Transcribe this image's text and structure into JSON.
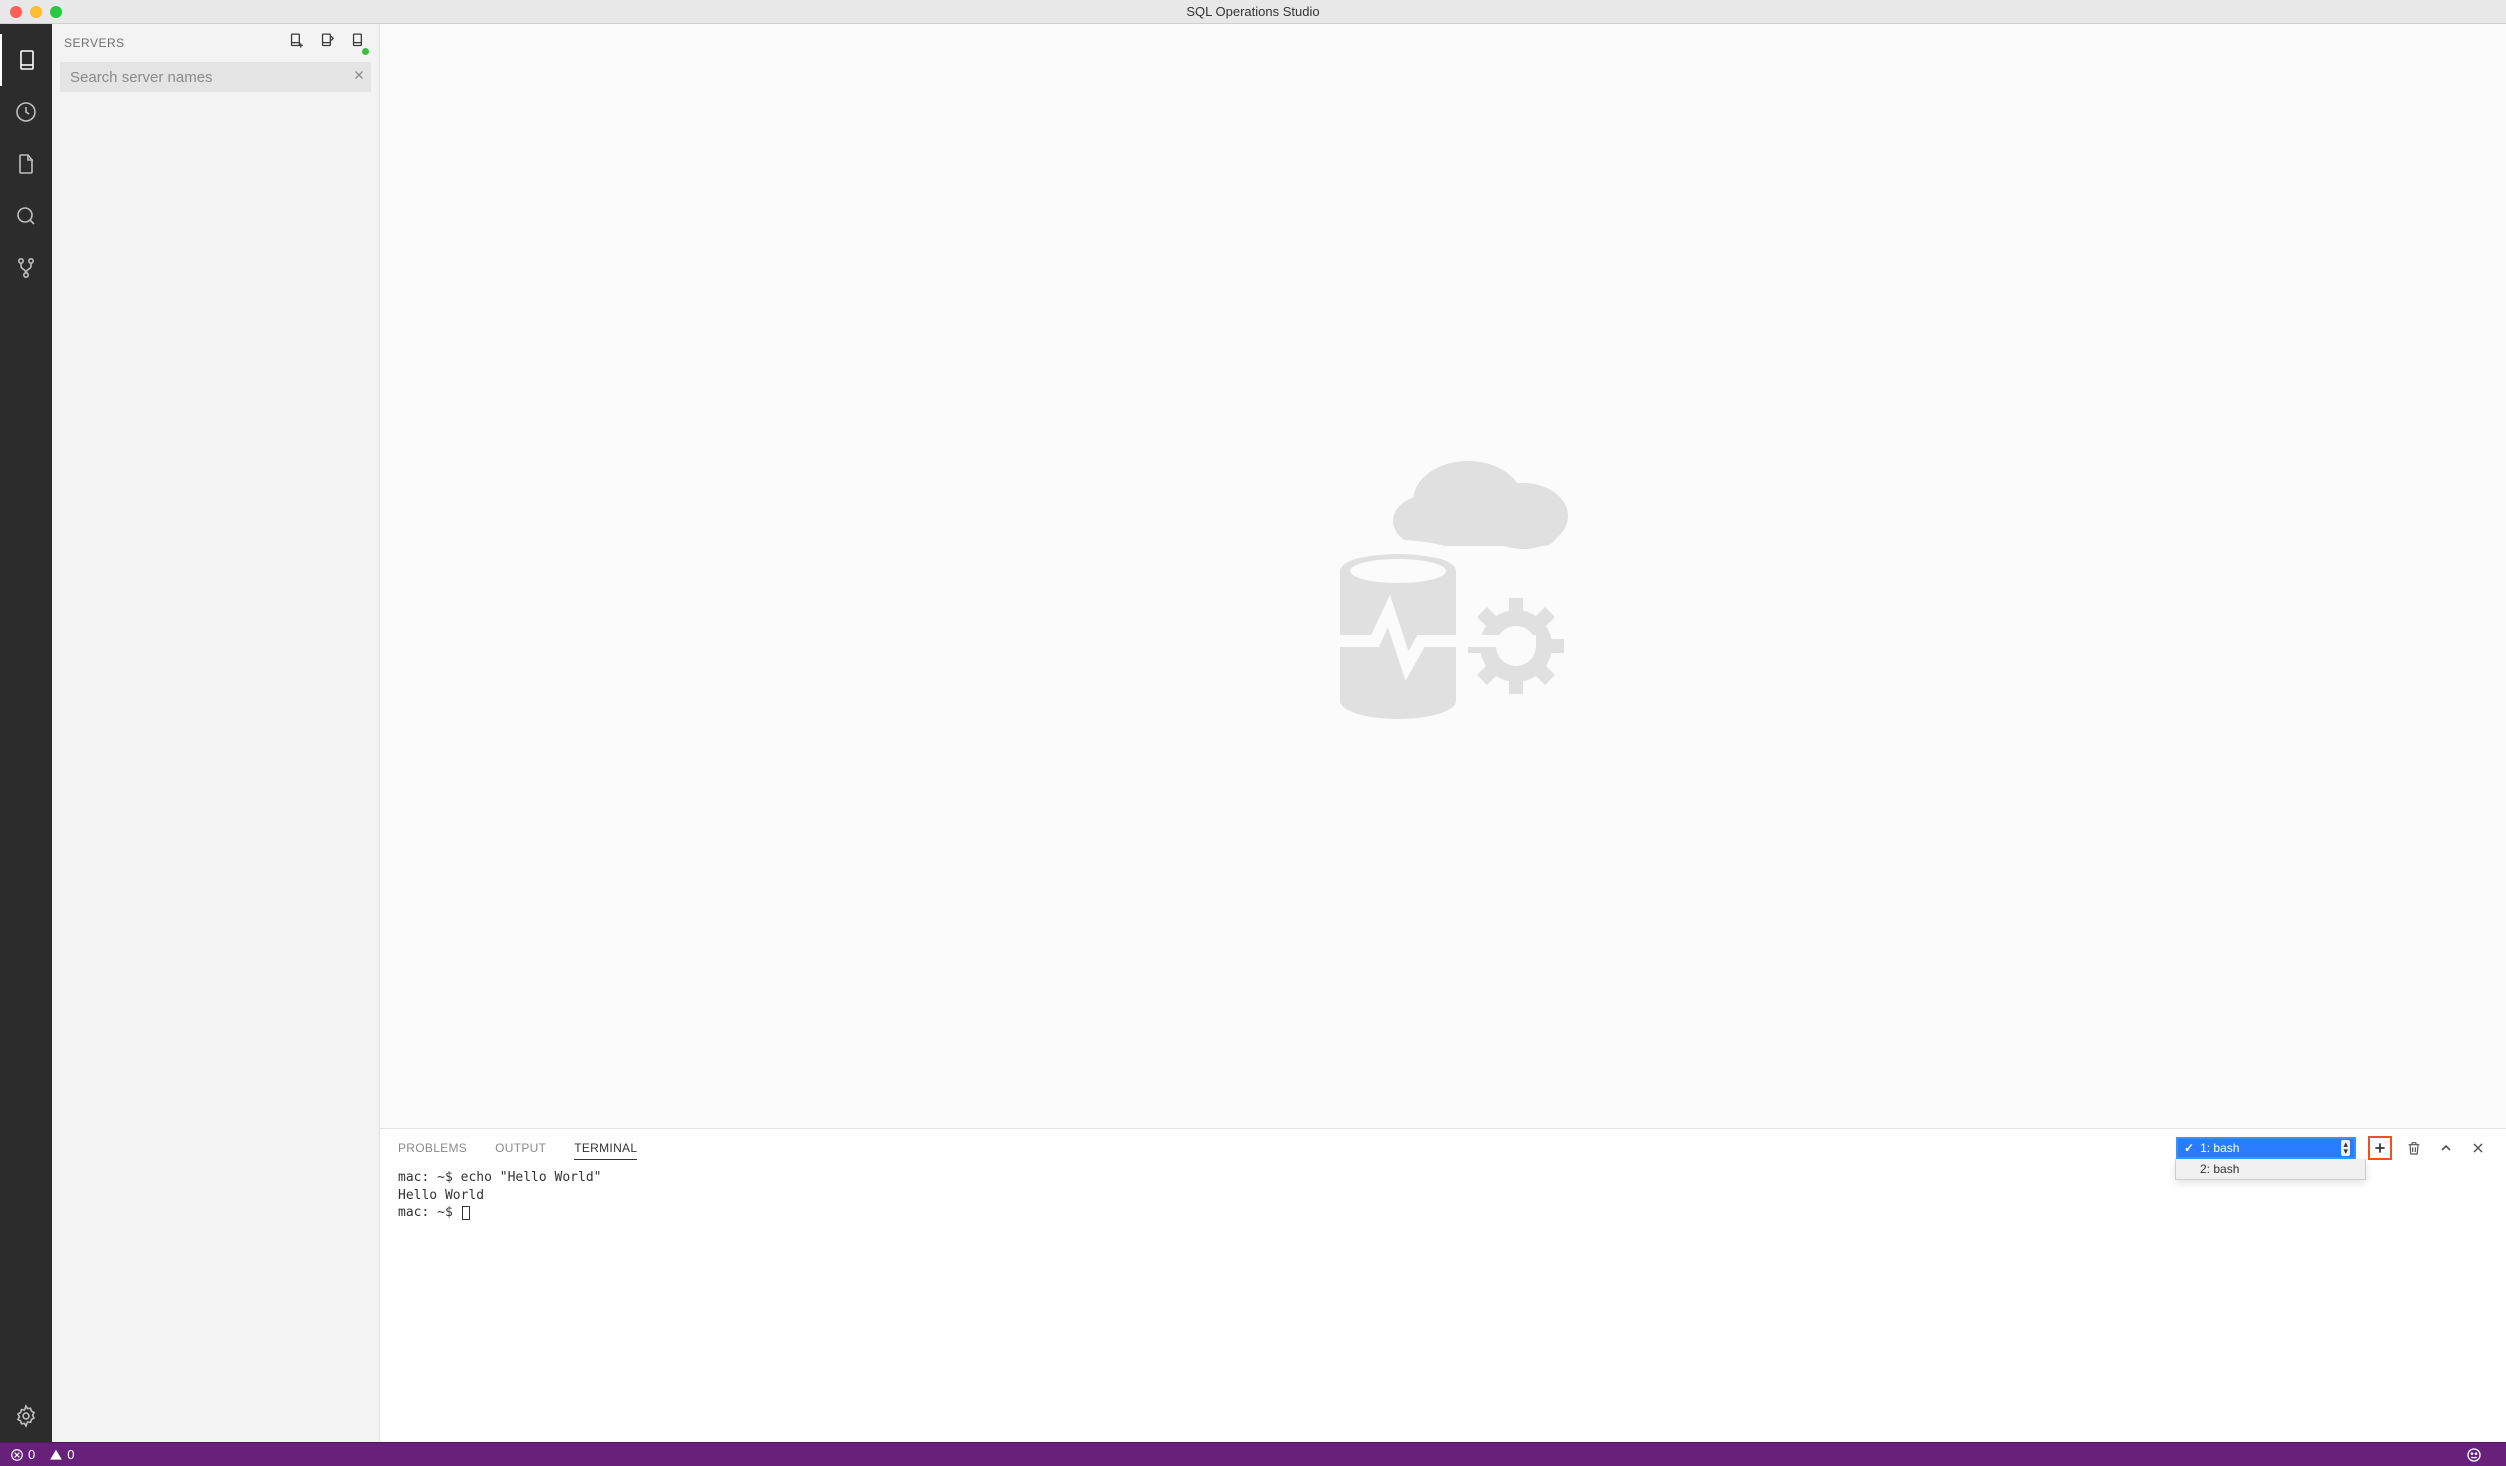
{
  "window": {
    "title": "SQL Operations Studio"
  },
  "sidebar": {
    "title": "SERVERS",
    "search_placeholder": "Search server names"
  },
  "panel": {
    "tabs": {
      "problems": "PROBLEMS",
      "output": "OUTPUT",
      "terminal": "TERMINAL"
    },
    "terminal_selector": {
      "selected": "1: bash",
      "options": [
        "1: bash",
        "2: bash"
      ]
    },
    "terminal_lines": [
      "mac: ~$ echo \"Hello World\"",
      "Hello World",
      "mac: ~$ "
    ]
  },
  "statusbar": {
    "errors": "0",
    "warnings": "0"
  },
  "colors": {
    "statusbar_bg": "#68217a",
    "highlight_orange": "#f04e23",
    "select_blue": "#2a7cff"
  }
}
